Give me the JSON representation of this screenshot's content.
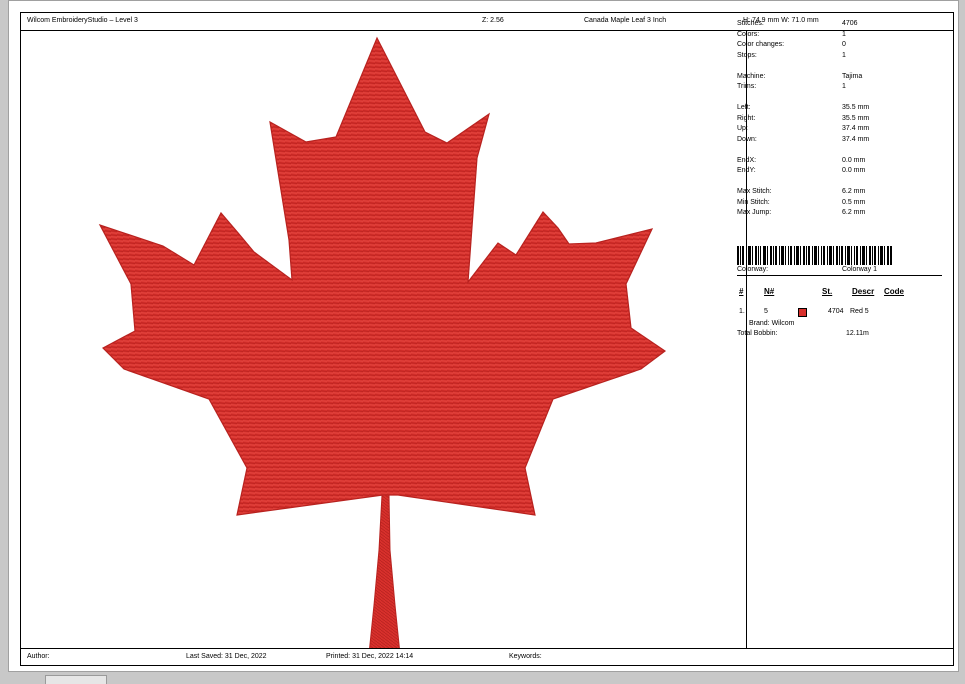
{
  "header": {
    "app_title": "Wilcom EmbroideryStudio – Level 3",
    "zoom": "Z: 2.56",
    "design_name": "Canada Maple Leaf 3 Inch",
    "dimensions": "H: 74.9 mm   W: 71.0 mm"
  },
  "stats": {
    "group1": [
      {
        "label": "Stitches:",
        "value": "4706"
      },
      {
        "label": "Colors:",
        "value": "1"
      },
      {
        "label": "Color changes:",
        "value": "0"
      },
      {
        "label": "Stops:",
        "value": "1"
      }
    ],
    "group2": [
      {
        "label": "Machine:",
        "value": "Tajima"
      },
      {
        "label": "Trims:",
        "value": "1"
      }
    ],
    "group3": [
      {
        "label": "Left:",
        "value": "35.5 mm"
      },
      {
        "label": "Right:",
        "value": "35.5 mm"
      },
      {
        "label": "Up:",
        "value": "37.4 mm"
      },
      {
        "label": "Down:",
        "value": "37.4 mm"
      }
    ],
    "group4": [
      {
        "label": "EndX:",
        "value": "0.0 mm"
      },
      {
        "label": "EndY:",
        "value": "0.0 mm"
      }
    ],
    "group5": [
      {
        "label": "Max Stitch:",
        "value": "6.2 mm"
      },
      {
        "label": "Min Stitch:",
        "value": "0.5 mm"
      },
      {
        "label": "Max Jump:",
        "value": "6.2 mm"
      }
    ]
  },
  "colorway": {
    "label": "Colorway:",
    "value": "Colorway 1"
  },
  "color_table": {
    "headers": {
      "num": "#",
      "needle": "N#",
      "st": "St.",
      "descr": "Descr",
      "code": "Code"
    },
    "rows": [
      {
        "num": "1.",
        "needle": "5",
        "swatch_color": "#d8302c",
        "stitches": "4704",
        "descr": "Red 5",
        "brand": "Brand: Wilcom"
      }
    ]
  },
  "bobbin": {
    "label": "Total Bobbin:",
    "value": "12.11m"
  },
  "footer": {
    "author": "Author:",
    "last_saved": "Last Saved: 31 Dec, 2022",
    "printed": "Printed: 31 Dec, 2022 14:14",
    "keywords": "Keywords:"
  },
  "colors": {
    "thread": "#d8302c",
    "thread_dark": "#b8221f",
    "thread_light": "#e8544c"
  }
}
